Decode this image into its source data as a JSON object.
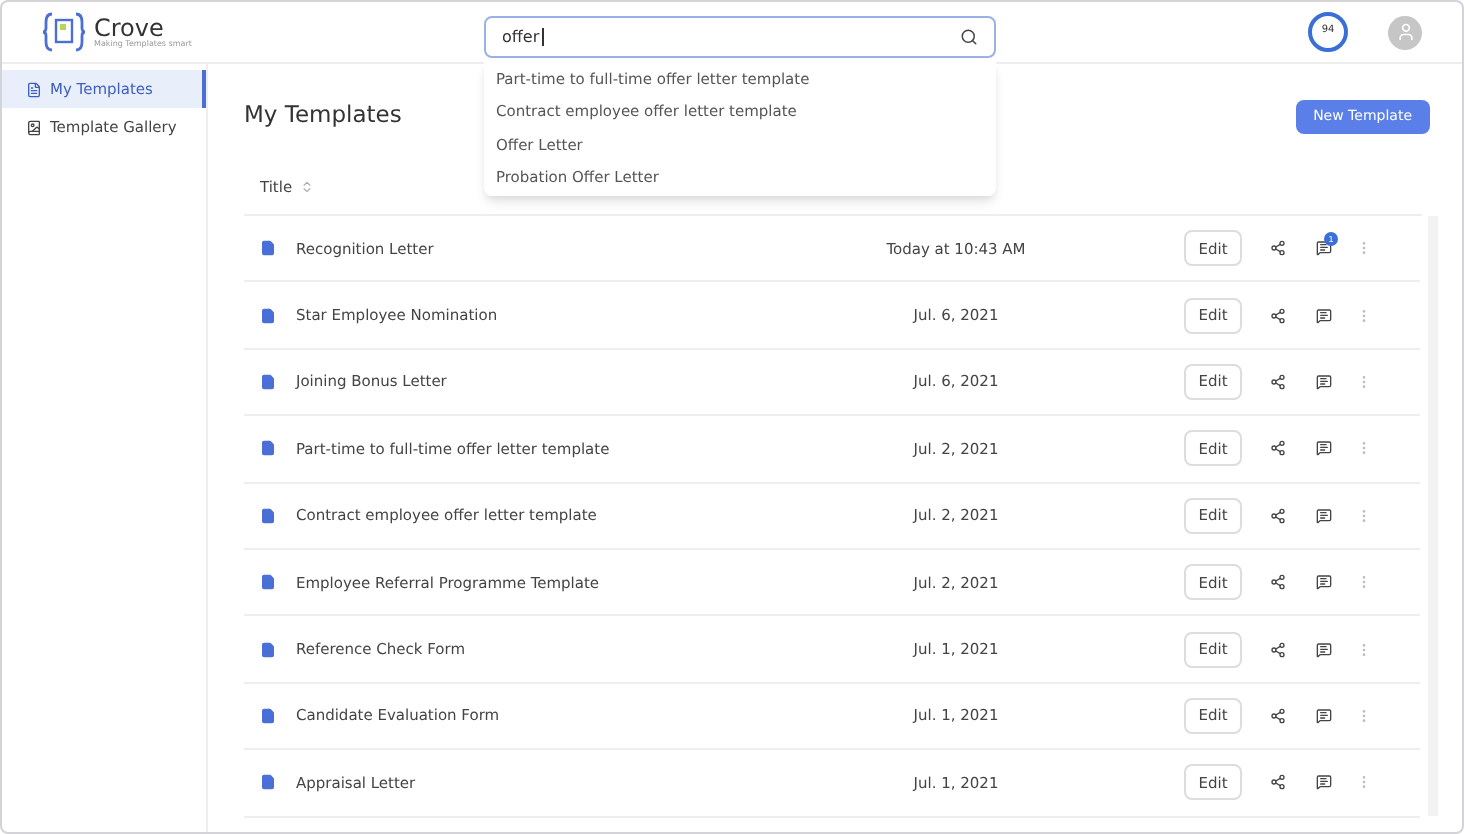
{
  "logo": {
    "name": "Crove",
    "tagline": "Making Templates smart"
  },
  "search": {
    "value": "offer",
    "suggestions": [
      "Part-time to full-time offer letter template",
      "Contract employee offer letter template",
      "Offer Letter",
      "Probation Offer Letter"
    ]
  },
  "score": "94",
  "sidebar": {
    "items": [
      {
        "label": "My Templates",
        "selected": true
      },
      {
        "label": "Template Gallery",
        "selected": false
      }
    ]
  },
  "page": {
    "title": "My Templates",
    "new_button": "New Template"
  },
  "table": {
    "columns": [
      "Title"
    ],
    "rows": [
      {
        "title": "Recognition Letter",
        "date": "Today at 10:43 AM",
        "edit": "Edit",
        "comments": "1"
      },
      {
        "title": "Star Employee Nomination",
        "date": "Jul. 6, 2021",
        "edit": "Edit"
      },
      {
        "title": "Joining Bonus Letter",
        "date": "Jul. 6, 2021",
        "edit": "Edit"
      },
      {
        "title": "Part-time to full-time offer letter template",
        "date": "Jul. 2, 2021",
        "edit": "Edit"
      },
      {
        "title": "Contract employee offer letter template",
        "date": "Jul. 2, 2021",
        "edit": "Edit"
      },
      {
        "title": "Employee Referral Programme Template",
        "date": "Jul. 2, 2021",
        "edit": "Edit"
      },
      {
        "title": "Reference Check Form",
        "date": "Jul. 1, 2021",
        "edit": "Edit"
      },
      {
        "title": "Candidate Evaluation Form",
        "date": "Jul. 1, 2021",
        "edit": "Edit"
      },
      {
        "title": "Appraisal Letter",
        "date": "Jul. 1, 2021",
        "edit": "Edit"
      }
    ]
  }
}
